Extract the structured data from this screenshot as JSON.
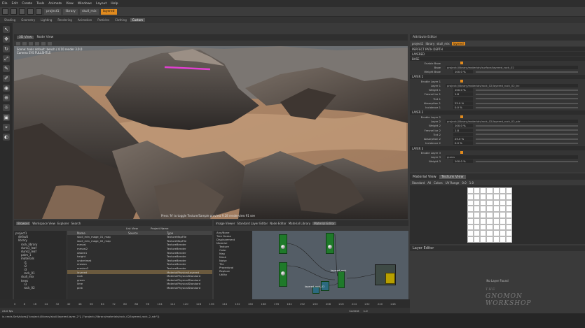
{
  "menubar": [
    "File",
    "Edit",
    "Create",
    "Tools",
    "Animate",
    "View",
    "Windows",
    "Layout",
    "Help"
  ],
  "shelf": {
    "paths": [
      "project1",
      "library",
      "skull_mix",
      "layered"
    ]
  },
  "shelf_tabs": [
    "Shading",
    "Geometry",
    "Lighting",
    "Rendering",
    "Animation",
    "Particles",
    "Clothing",
    "Custom"
  ],
  "viewport": {
    "tabs": [
      "3D View",
      "Node View"
    ],
    "info_lines": [
      "Scene: tools default: bench / 4.10 render 3.0.0",
      "Camera  SYS FULLSHTLS"
    ],
    "status": "Press 'N' to toggle Texture/Sample preview 9.28 renderview 91 see"
  },
  "attribute_editor": {
    "tabs": [
      "Attribute Editor"
    ],
    "path": [
      "project1",
      "library",
      "skull_mix",
      "layered"
    ],
    "sections": [
      {
        "title": "PERFECT PATH DEPTH",
        "rows": []
      },
      {
        "title": "LAYERED",
        "rows": []
      },
      {
        "title": "BASE",
        "rows": [
          {
            "label": "Enable Base",
            "type": "check"
          },
          {
            "label": "Base",
            "type": "text",
            "value": "project://library/materials/surface/layered_rock_02"
          },
          {
            "label": "Weight Base",
            "type": "num",
            "value": "100.0 %"
          }
        ]
      },
      {
        "title": "LAYER 1",
        "rows": [
          {
            "label": "Enable Layer 1",
            "type": "check"
          },
          {
            "label": "Layer 1",
            "type": "text",
            "value": "project://library/materials/rock_02/layered_rock_02_trc"
          },
          {
            "label": "Weight 1",
            "type": "num",
            "value": "100.0 %"
          },
          {
            "label": "Fresnel Ior 1",
            "type": "num",
            "value": "1.8"
          },
          {
            "label": "Tint 1",
            "type": "num",
            "value": ""
          },
          {
            "label": "Absorption 1",
            "type": "num",
            "value": "25.0 %"
          },
          {
            "label": "Incidence 1",
            "type": "num",
            "value": "0.0 %"
          }
        ]
      },
      {
        "title": "LAYER 2",
        "rows": [
          {
            "label": "Enable Layer 2",
            "type": "check"
          },
          {
            "label": "Layer 2",
            "type": "text",
            "value": "project://library/materials/rock_02/layered_rock_02_sdr"
          },
          {
            "label": "Weight 2",
            "type": "num",
            "value": "100.0 %"
          },
          {
            "label": "Fresnel Ior 2",
            "type": "num",
            "value": "1.8"
          },
          {
            "label": "Tint 2",
            "type": "num",
            "value": ""
          },
          {
            "label": "Absorption 2",
            "type": "num",
            "value": "25.0 %"
          },
          {
            "label": "Incidence 2",
            "type": "num",
            "value": "0.0 %"
          }
        ]
      },
      {
        "title": "LAYER 3",
        "rows": [
          {
            "label": "Enable Layer 3",
            "type": "check"
          },
          {
            "label": "Layer 3",
            "type": "text",
            "value": "guess"
          },
          {
            "label": "Weight 3",
            "type": "num",
            "value": "100.0 %"
          }
        ]
      }
    ]
  },
  "texture_view": {
    "tabs": [
      "Material View",
      "Texture View"
    ],
    "toolbar": [
      "Standard",
      "All",
      "Colors",
      "UV Range",
      "0.0",
      "1.0"
    ]
  },
  "layer_editor": {
    "title": "Layer Editor",
    "empty": "No Layer Found"
  },
  "watermark": {
    "line1": "THE",
    "line2": "GNOMON",
    "line3": "WORKSHOP"
  },
  "browser": {
    "tabs": [
      "Browser",
      "Workspace View",
      "Explorer",
      "Search"
    ],
    "filters": [
      "List View",
      "Project Name"
    ],
    "outliner": [
      "project1",
      "default",
      "library",
      "rock_library",
      "dunk1_leaf",
      "dunk2_leaf",
      "palm_1",
      "materials",
      "r1",
      "r2",
      "r3",
      "rock_01",
      "skull_mix",
      "trees",
      "r3",
      "rock_02"
    ],
    "columns": [
      "Name",
      "Source",
      "Type"
    ],
    "rows": [
      {
        "name": "skull_mtn_mage_01_map",
        "source": "",
        "type": "TextureMapFile"
      },
      {
        "name": "skull_mtn_mage_02_map",
        "source": "",
        "type": "TextureMapFile"
      },
      {
        "name": "mmasl",
        "source": "",
        "type": "TextureBender"
      },
      {
        "name": "mmasl2",
        "source": "",
        "type": "TextureBender"
      },
      {
        "name": "dabee1",
        "source": "",
        "type": "TextureBender"
      },
      {
        "name": "height",
        "source": "",
        "type": "TextureBender"
      },
      {
        "name": "undertreat",
        "source": "",
        "type": "TextureBender"
      },
      {
        "name": "erosion",
        "source": "",
        "type": "TextureBender"
      },
      {
        "name": "erosion2",
        "source": "",
        "type": "TextureBender"
      },
      {
        "name": "layered",
        "source": "",
        "type": "MaterialPhysicalLayered"
      },
      {
        "name": "rock",
        "source": "",
        "type": "MaterialPhysicalStandard"
      },
      {
        "name": "green",
        "source": "",
        "type": "MaterialPhysicalStandard"
      },
      {
        "name": "lime",
        "source": "",
        "type": "MaterialPhysicalStandard"
      },
      {
        "name": "pink",
        "source": "",
        "type": "MaterialPhysicalStandard"
      }
    ]
  },
  "material_editor": {
    "tabs": [
      "Image Viewer",
      "Standard Layer Editor",
      "Node Editor",
      "Material Library",
      "Material Editor"
    ],
    "list": [
      "Any/None",
      "Tree Guess",
      "Displacement",
      "Material",
      "Texture",
      "Color",
      "Map",
      "Mask",
      "Noise",
      "Tile",
      "Procedural",
      "Replace",
      "Utility"
    ],
    "node_labels": [
      "layered_rock",
      "layered_rock_02",
      "layered_rock_03",
      "rock_01"
    ]
  },
  "timeline": {
    "ticks": [
      "0",
      "8",
      "16",
      "24",
      "32",
      "40",
      "48",
      "56",
      "64",
      "72",
      "80",
      "88",
      "96",
      "104",
      "112",
      "120",
      "128",
      "136",
      "144",
      "152",
      "160",
      "168",
      "176",
      "184",
      "192",
      "200",
      "208",
      "216",
      "224",
      "232",
      "240",
      "248"
    ],
    "fps": "24.0 fps",
    "current": "Current",
    "frame": "1.0"
  },
  "cmdline": "ix.cmds.SetValues([\"project://library/skull/layered.layer_2\"], [\"project://library/materials/rock_02/layered_rock_2_sdr\"])"
}
